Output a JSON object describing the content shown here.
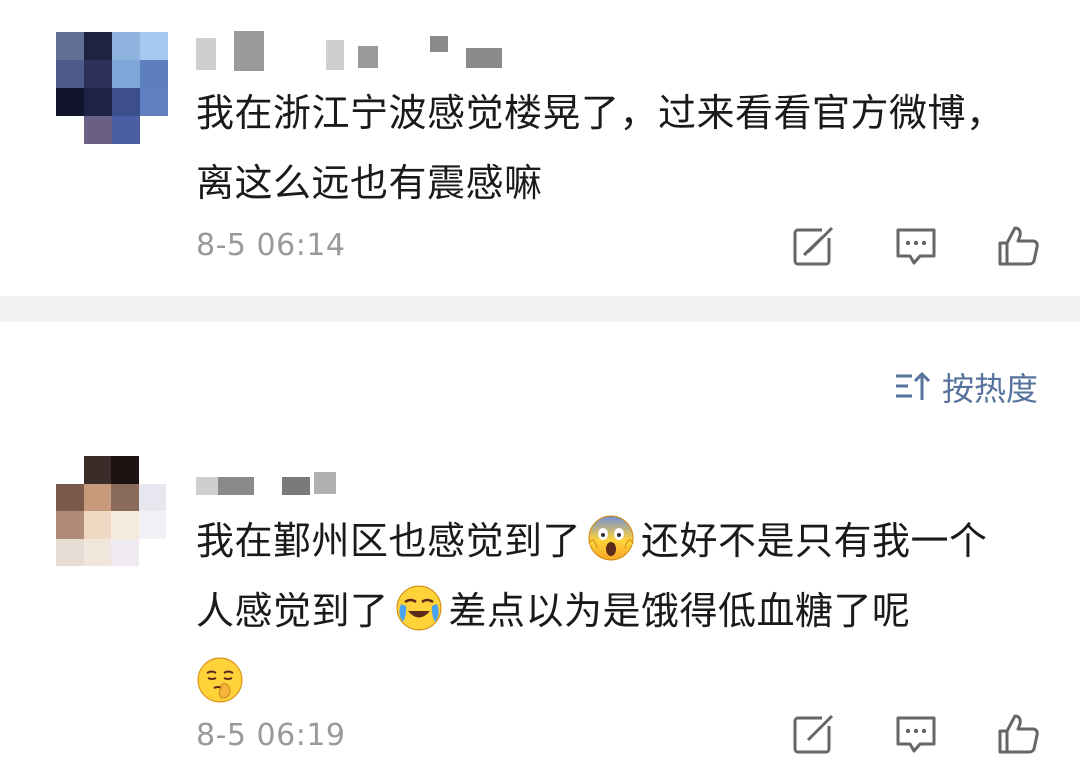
{
  "comments": [
    {
      "text": "我在浙江宁波感觉楼晃了，过来看看官方微博，离这么远也有震感嘛",
      "time": "8-5 06:14",
      "icons": [
        "share-icon",
        "comment-icon",
        "like-icon"
      ]
    },
    {
      "text_part1": "我在鄞州区也感觉到了",
      "emoji1": "screaming-face-emoji",
      "text_part2": "还好不是只有我一个人感觉到了",
      "emoji2": "loudly-crying-face-emoji",
      "text_part3": "差点以为是饿得低血糖了呢",
      "emoji3": "shushing-face-emoji",
      "time": "8-5 06:19",
      "icons": [
        "share-icon",
        "comment-icon",
        "like-icon"
      ]
    }
  ],
  "sort": {
    "label": "按热度",
    "icon": "sort-icon",
    "color": "#55739d"
  },
  "colors": {
    "text": "#1a1a1a",
    "time": "#9a9a9a",
    "icon": "#666666",
    "separator": "#f2f2f2"
  }
}
